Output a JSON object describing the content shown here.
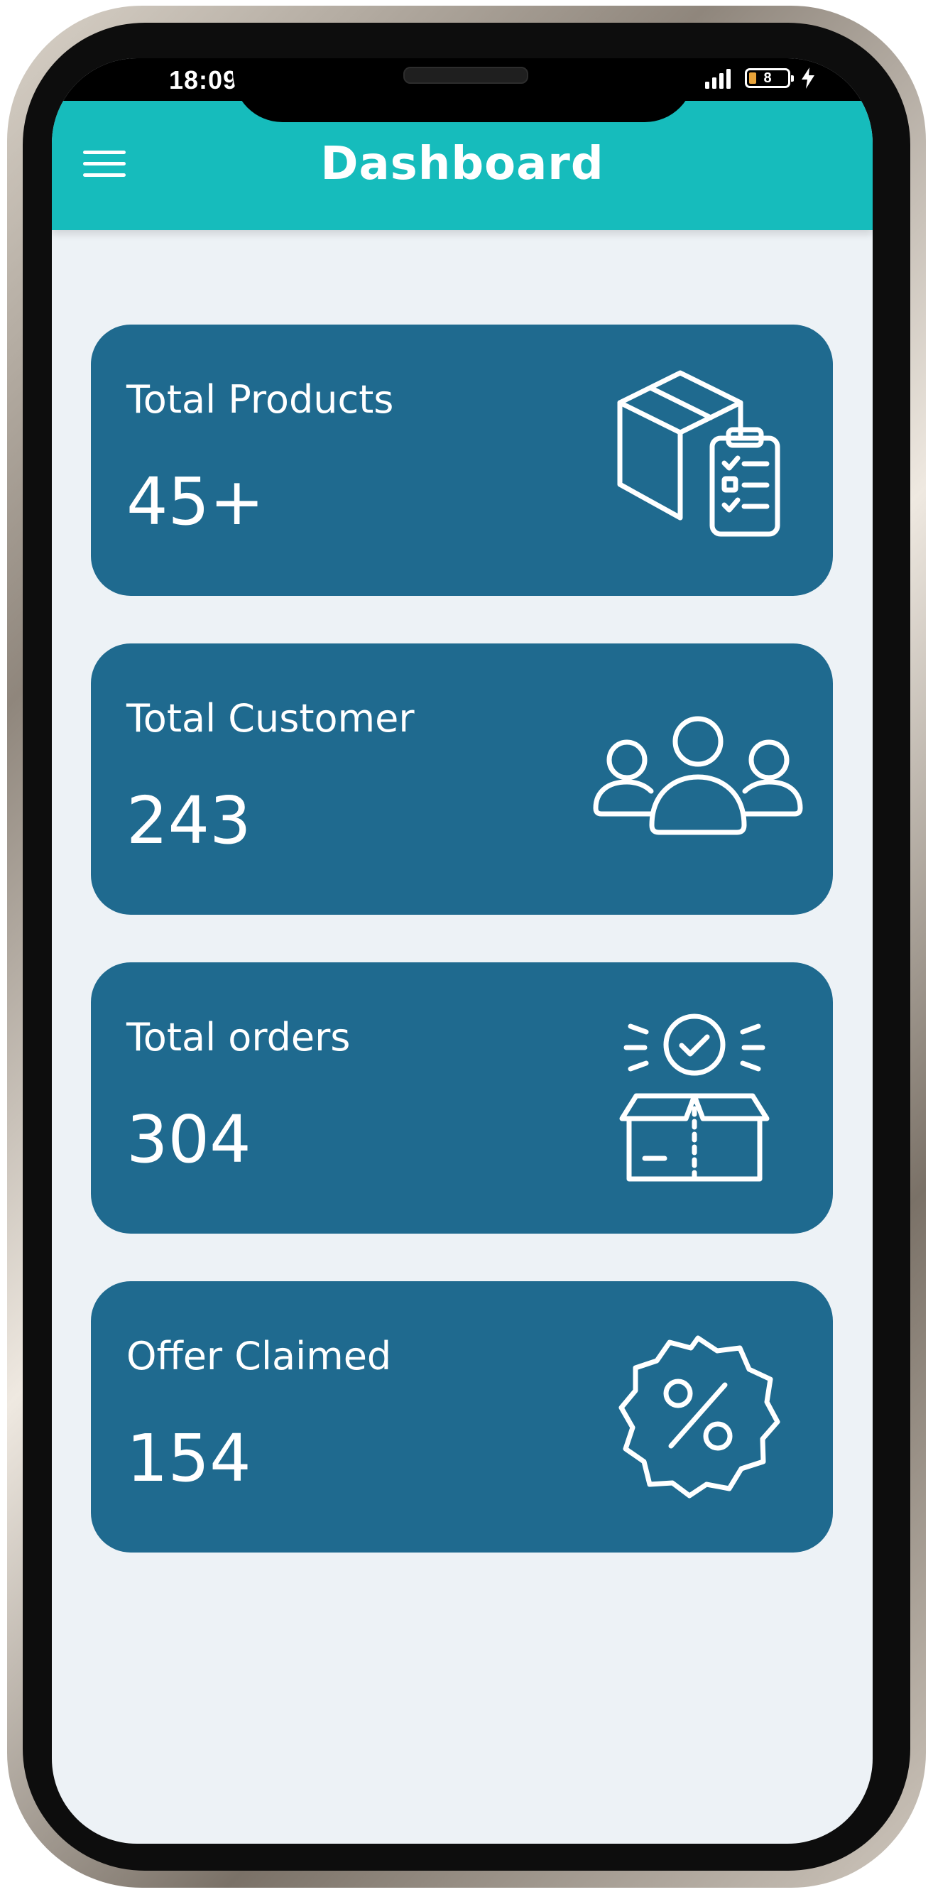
{
  "status_bar": {
    "time": "18:09",
    "battery": "8"
  },
  "header": {
    "title": "Dashboard",
    "menu_icon": "hamburger-menu-icon"
  },
  "cards": [
    {
      "label": "Total Products",
      "value": "45+",
      "icon": "product-box-checklist-icon"
    },
    {
      "label": "Total Customer",
      "value": "243",
      "icon": "customers-group-icon"
    },
    {
      "label": "Total orders",
      "value": "304",
      "icon": "order-box-check-icon"
    },
    {
      "label": "Offer Claimed",
      "value": "154",
      "icon": "discount-badge-icon"
    }
  ],
  "colors": {
    "app_bar": "#16bcbc",
    "card": "#1f6a8f",
    "background": "#edf2f6"
  }
}
